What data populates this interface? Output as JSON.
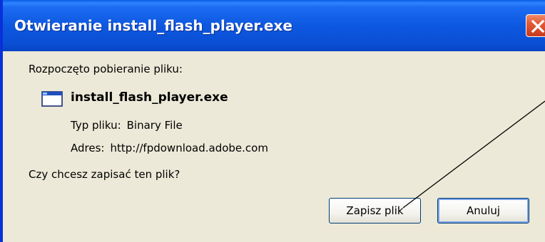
{
  "dialog": {
    "title": "Otwieranie install_flash_player.exe",
    "intro": "Rozpoczęto pobieranie pliku:",
    "file_name": "install_flash_player.exe",
    "file_type_label": "Typ pliku:",
    "file_type_value": "Binary File",
    "address_label": "Adres:",
    "address_value": "http://fpdownload.adobe.com",
    "question": "Czy chcesz zapisać ten plik?",
    "save_label": "Zapisz plik",
    "cancel_label": "Anuluj"
  },
  "icons": {
    "close": "close-icon",
    "file": "window-app-icon"
  },
  "colors": {
    "titlebar": "#0a55dd",
    "dialog_bg": "#ece9d8",
    "close_button": "#e35a35",
    "button_border": "#003c74",
    "annotation_line": "#000000"
  }
}
